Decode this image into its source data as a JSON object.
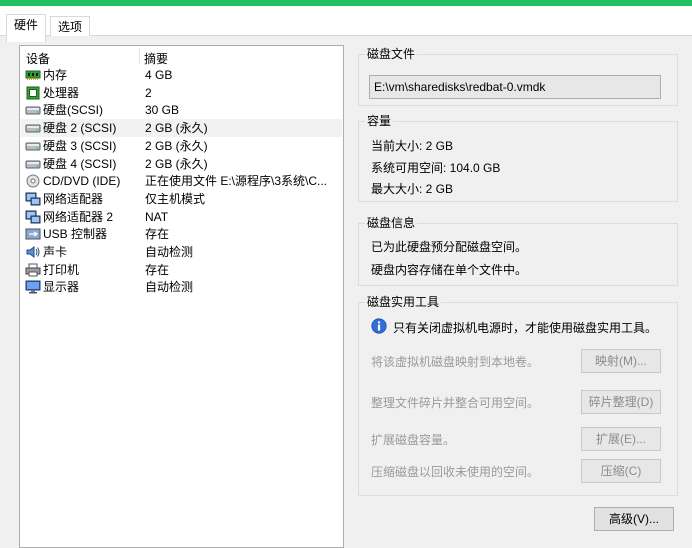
{
  "tabs": [
    "硬件",
    "选项"
  ],
  "device_list": {
    "col_device": "设备",
    "col_summary": "摘要",
    "rows": [
      {
        "name": "内存",
        "summary": "4 GB",
        "icon": "memory-icon"
      },
      {
        "name": "处理器",
        "summary": "2",
        "icon": "cpu-icon"
      },
      {
        "name": "硬盘(SCSI)",
        "summary": "30 GB",
        "icon": "disk-icon"
      },
      {
        "name": "硬盘 2 (SCSI)",
        "summary": "2 GB (永久)",
        "icon": "disk-icon"
      },
      {
        "name": "硬盘 3 (SCSI)",
        "summary": "2 GB (永久)",
        "icon": "disk-icon"
      },
      {
        "name": "硬盘 4 (SCSI)",
        "summary": "2 GB (永久)",
        "icon": "disk-icon"
      },
      {
        "name": "CD/DVD (IDE)",
        "summary": "正在使用文件 E:\\源程序\\3系统\\C...",
        "icon": "cd-icon"
      },
      {
        "name": "网络适配器",
        "summary": "仅主机模式",
        "icon": "network-icon"
      },
      {
        "name": "网络适配器 2",
        "summary": "NAT",
        "icon": "network-icon"
      },
      {
        "name": "USB 控制器",
        "summary": "存在",
        "icon": "usb-icon"
      },
      {
        "name": "声卡",
        "summary": "自动检测",
        "icon": "speaker-icon"
      },
      {
        "name": "打印机",
        "summary": "存在",
        "icon": "printer-icon"
      },
      {
        "name": "显示器",
        "summary": "自动检测",
        "icon": "monitor-icon"
      }
    ],
    "selected_index": 3
  },
  "disk_file": {
    "title": "磁盘文件",
    "path": "E:\\vm\\sharedisks\\redbat-0.vmdk"
  },
  "capacity": {
    "title": "容量",
    "current": "当前大小: 2 GB",
    "available": "系统可用空间: 104.0 GB",
    "max": "最大大小: 2 GB"
  },
  "disk_info": {
    "title": "磁盘信息",
    "line1": "已为此硬盘预分配磁盘空间。",
    "line2": "硬盘内容存储在单个文件中。"
  },
  "utilities": {
    "title": "磁盘实用工具",
    "notice": "只有关闭虚拟机电源时，才能使用磁盘实用工具。",
    "map_label": "将该虚拟机磁盘映射到本地卷。",
    "map_button": "映射(M)...",
    "defrag_label": "整理文件碎片并整合可用空间。",
    "defrag_button": "碎片整理(D)",
    "expand_label": "扩展磁盘容量。",
    "expand_button": "扩展(E)...",
    "compact_label": "压缩磁盘以回收未使用的空间。",
    "compact_button": "压缩(C)"
  },
  "advanced_button": "高级(V)...",
  "colors": {
    "accent_bar": "#1fc162",
    "panel_bg": "#f0f0f0",
    "disabled_text": "#9a9a9a"
  }
}
